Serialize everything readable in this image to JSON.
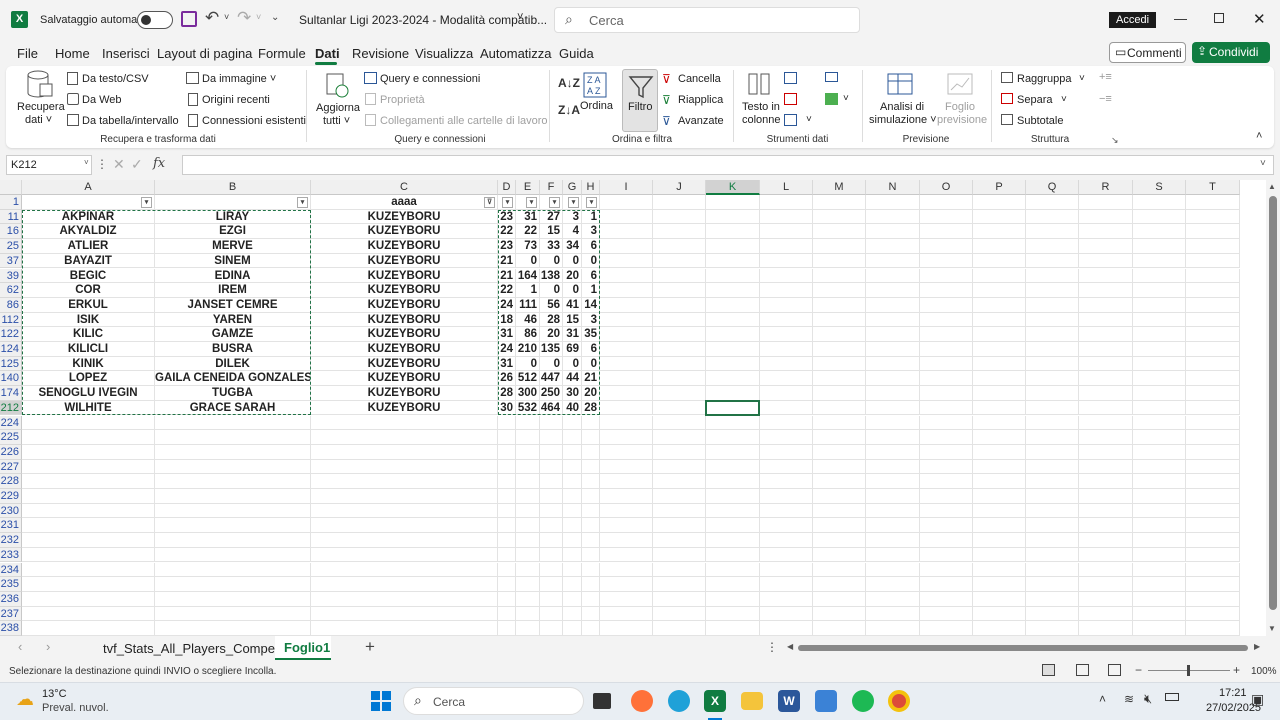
{
  "titlebar": {
    "autosave": "Salvataggio automatico",
    "doc_title": "Sultanlar Ligi 2023-2024 - Modalità compatib...",
    "search": "Cerca",
    "signin": "Accedi"
  },
  "menu": [
    "File",
    "Home",
    "Inserisci",
    "Layout di pagina",
    "Formule",
    "Dati",
    "Revisione",
    "Visualizza",
    "Automatizza",
    "Guida"
  ],
  "active_menu": "Dati",
  "actions": {
    "comments": "Commenti",
    "share": "Condividi"
  },
  "ribbon": {
    "recupera": "Recupera",
    "recupera2": "dati ˅",
    "testo_csv": "Da testo/CSV",
    "web": "Da Web",
    "tabella": "Da tabella/intervallo",
    "immagine": "Da immagine ˅",
    "recenti": "Origini recenti",
    "connessioni": "Connessioni esistenti",
    "g1": "Recupera e trasforma dati",
    "aggiorna": "Aggiorna",
    "aggiorna2": "tutti ˅",
    "query": "Query e connessioni",
    "proprieta": "Proprietà",
    "collegamenti": "Collegamenti alle cartelle di lavoro",
    "g2": "Query e connessioni",
    "ordina": "Ordina",
    "filtro": "Filtro",
    "cancella": "Cancella",
    "riapplica": "Riapplica",
    "avanzate": "Avanzate",
    "g3": "Ordina e filtra",
    "testo_colonne": "Testo in",
    "testo_colonne2": "colonne",
    "g4": "Strumenti dati",
    "analisi": "Analisi di",
    "analisi2": "simulazione ˅",
    "foglio": "Foglio",
    "foglio2": "previsione",
    "g5": "Previsione",
    "raggruppa": "Raggruppa",
    "separa": "Separa",
    "subtotale": "Subtotale",
    "g6": "Struttura"
  },
  "namebox": "K212",
  "columns": [
    "A",
    "B",
    "C",
    "D",
    "E",
    "F",
    "G",
    "H",
    "I",
    "J",
    "K",
    "L",
    "M",
    "N",
    "O",
    "P",
    "Q",
    "R",
    "S",
    "T"
  ],
  "header_row": {
    "num": "1",
    "c": "aaaa"
  },
  "rows": [
    {
      "num": "11",
      "a": "AKPINAR",
      "b": "LIRAY",
      "c": "KUZEYBORU",
      "d": "23",
      "e": "31",
      "f": "27",
      "g": "3",
      "h": "1"
    },
    {
      "num": "16",
      "a": "AKYALDIZ",
      "b": "EZGI",
      "c": "KUZEYBORU",
      "d": "22",
      "e": "22",
      "f": "15",
      "g": "4",
      "h": "3"
    },
    {
      "num": "25",
      "a": "ATLIER",
      "b": "MERVE",
      "c": "KUZEYBORU",
      "d": "23",
      "e": "73",
      "f": "33",
      "g": "34",
      "h": "6"
    },
    {
      "num": "37",
      "a": "BAYAZIT",
      "b": "SINEM",
      "c": "KUZEYBORU",
      "d": "21",
      "e": "0",
      "f": "0",
      "g": "0",
      "h": "0"
    },
    {
      "num": "39",
      "a": "BEGIC",
      "b": "EDINA",
      "c": "KUZEYBORU",
      "d": "21",
      "e": "164",
      "f": "138",
      "g": "20",
      "h": "6"
    },
    {
      "num": "62",
      "a": "COR",
      "b": "IREM",
      "c": "KUZEYBORU",
      "d": "22",
      "e": "1",
      "f": "0",
      "g": "0",
      "h": "1"
    },
    {
      "num": "86",
      "a": "ERKUL",
      "b": "JANSET CEMRE",
      "c": "KUZEYBORU",
      "d": "24",
      "e": "111",
      "f": "56",
      "g": "41",
      "h": "14"
    },
    {
      "num": "112",
      "a": "ISIK",
      "b": "YAREN",
      "c": "KUZEYBORU",
      "d": "18",
      "e": "46",
      "f": "28",
      "g": "15",
      "h": "3"
    },
    {
      "num": "122",
      "a": "KILIC",
      "b": "GAMZE",
      "c": "KUZEYBORU",
      "d": "31",
      "e": "86",
      "f": "20",
      "g": "31",
      "h": "35"
    },
    {
      "num": "124",
      "a": "KILICLI",
      "b": "BUSRA",
      "c": "KUZEYBORU",
      "d": "24",
      "e": "210",
      "f": "135",
      "g": "69",
      "h": "6"
    },
    {
      "num": "125",
      "a": "KINIK",
      "b": "DILEK",
      "c": "KUZEYBORU",
      "d": "31",
      "e": "0",
      "f": "0",
      "g": "0",
      "h": "0"
    },
    {
      "num": "140",
      "a": "LOPEZ",
      "b": "GAILA CENEIDA GONZALES",
      "c": "KUZEYBORU",
      "d": "26",
      "e": "512",
      "f": "447",
      "g": "44",
      "h": "21"
    },
    {
      "num": "174",
      "a": "SENOGLU IVEGIN",
      "b": "TUGBA",
      "c": "KUZEYBORU",
      "d": "28",
      "e": "300",
      "f": "250",
      "g": "30",
      "h": "20"
    },
    {
      "num": "212",
      "a": "WILHITE",
      "b": "GRACE SARAH",
      "c": "KUZEYBORU",
      "d": "30",
      "e": "532",
      "f": "464",
      "g": "40",
      "h": "28"
    }
  ],
  "empty_rows": [
    "224",
    "225",
    "226",
    "227",
    "228",
    "229",
    "230",
    "231",
    "232",
    "233",
    "234",
    "235",
    "236",
    "237",
    "238"
  ],
  "sheets": [
    "tvf_Stats_All_Players_Competiti",
    "Foglio1"
  ],
  "active_sheet": "Foglio1",
  "status_text": "Selezionare la destinazione quindi INVIO o scegliere Incolla.",
  "zoom": "100%",
  "weather": {
    "temp": "13°C",
    "desc": "Preval. nuvol."
  },
  "taskbar_search": "Cerca",
  "clock": {
    "time": "17:21",
    "date": "27/02/2025"
  }
}
